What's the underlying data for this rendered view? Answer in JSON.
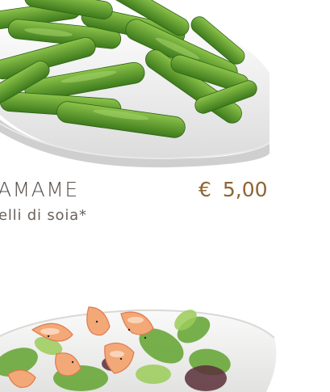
{
  "menu": {
    "items": [
      {
        "name": "AMAME",
        "description": "elli di soia*",
        "currency": "€",
        "price": "5,00",
        "image_icon": "edamame-plate-photo"
      },
      {
        "image_icon": "shrimp-salad-plate-photo"
      }
    ]
  },
  "colors": {
    "name_text": "#57504b",
    "description_text": "#6a625d",
    "price_text": "#8e6535",
    "plate": "#f4f4f2",
    "edamame_green": "#5f9a2c",
    "shrimp": "#f0a070",
    "lettuce": "#6aa83a"
  }
}
